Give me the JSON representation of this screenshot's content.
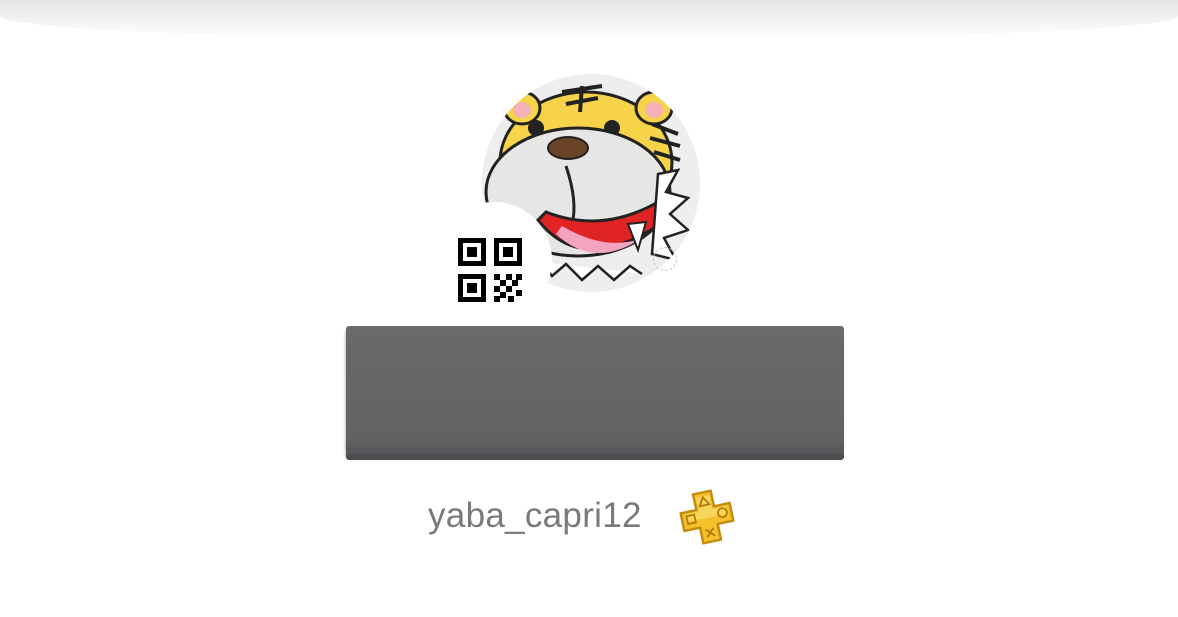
{
  "profile": {
    "username": "yaba_capri12",
    "avatar": "tiger-avatar",
    "qr_icon": "qr-code-icon",
    "badge_icon": "playstation-plus-icon"
  },
  "colors": {
    "username_text": "#7a7a7a",
    "name_plate": "#666668",
    "ps_plus_gold": "#f3c22a"
  }
}
